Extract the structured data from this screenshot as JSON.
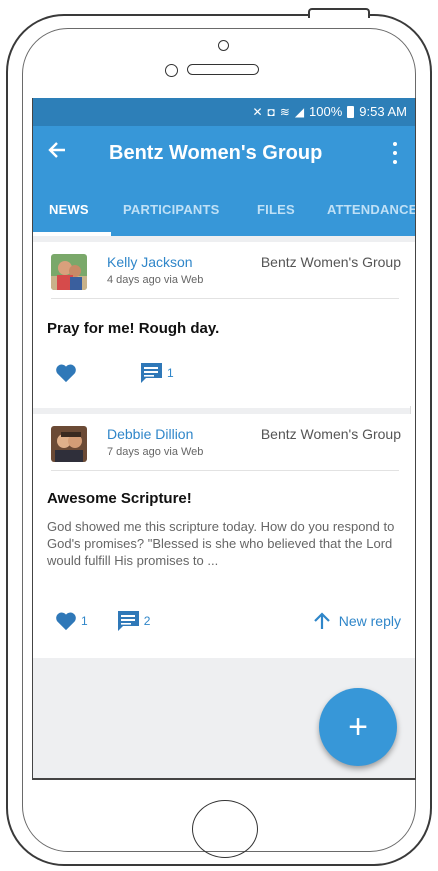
{
  "status_bar": {
    "battery": "100%",
    "time": "9:53 AM"
  },
  "app_bar": {
    "title": "Bentz Women's Group"
  },
  "tabs": [
    {
      "label": "NEWS",
      "active": true
    },
    {
      "label": "PARTICIPANTS",
      "active": false
    },
    {
      "label": "FILES",
      "active": false
    },
    {
      "label": "ATTENDANCE",
      "active": false
    }
  ],
  "posts": [
    {
      "author": "Kelly Jackson",
      "meta": "4 days ago via Web",
      "group": "Bentz Women's Group",
      "title": "Pray for me!  Rough day.",
      "body": "",
      "like_count": "",
      "comment_count": "1"
    },
    {
      "author": "Debbie Dillion",
      "meta": "7 days ago via Web",
      "group": "Bentz Women's Group",
      "title": "Awesome Scripture!",
      "body": "God showed me this scripture today.  How do you respond to God's promises?  \"Blessed is she who believed that the Lord would fulfill His promises to ...",
      "like_count": "1",
      "comment_count": "2",
      "new_reply_label": "New reply"
    }
  ],
  "fab": {
    "label": "+"
  },
  "colors": {
    "primary": "#3797d8",
    "status": "#2d7fb8",
    "link": "#2f86c9"
  },
  "icons": [
    "back-arrow-icon",
    "more-vert-icon",
    "heart-icon",
    "comment-icon",
    "arrow-up-icon",
    "plus-icon"
  ]
}
